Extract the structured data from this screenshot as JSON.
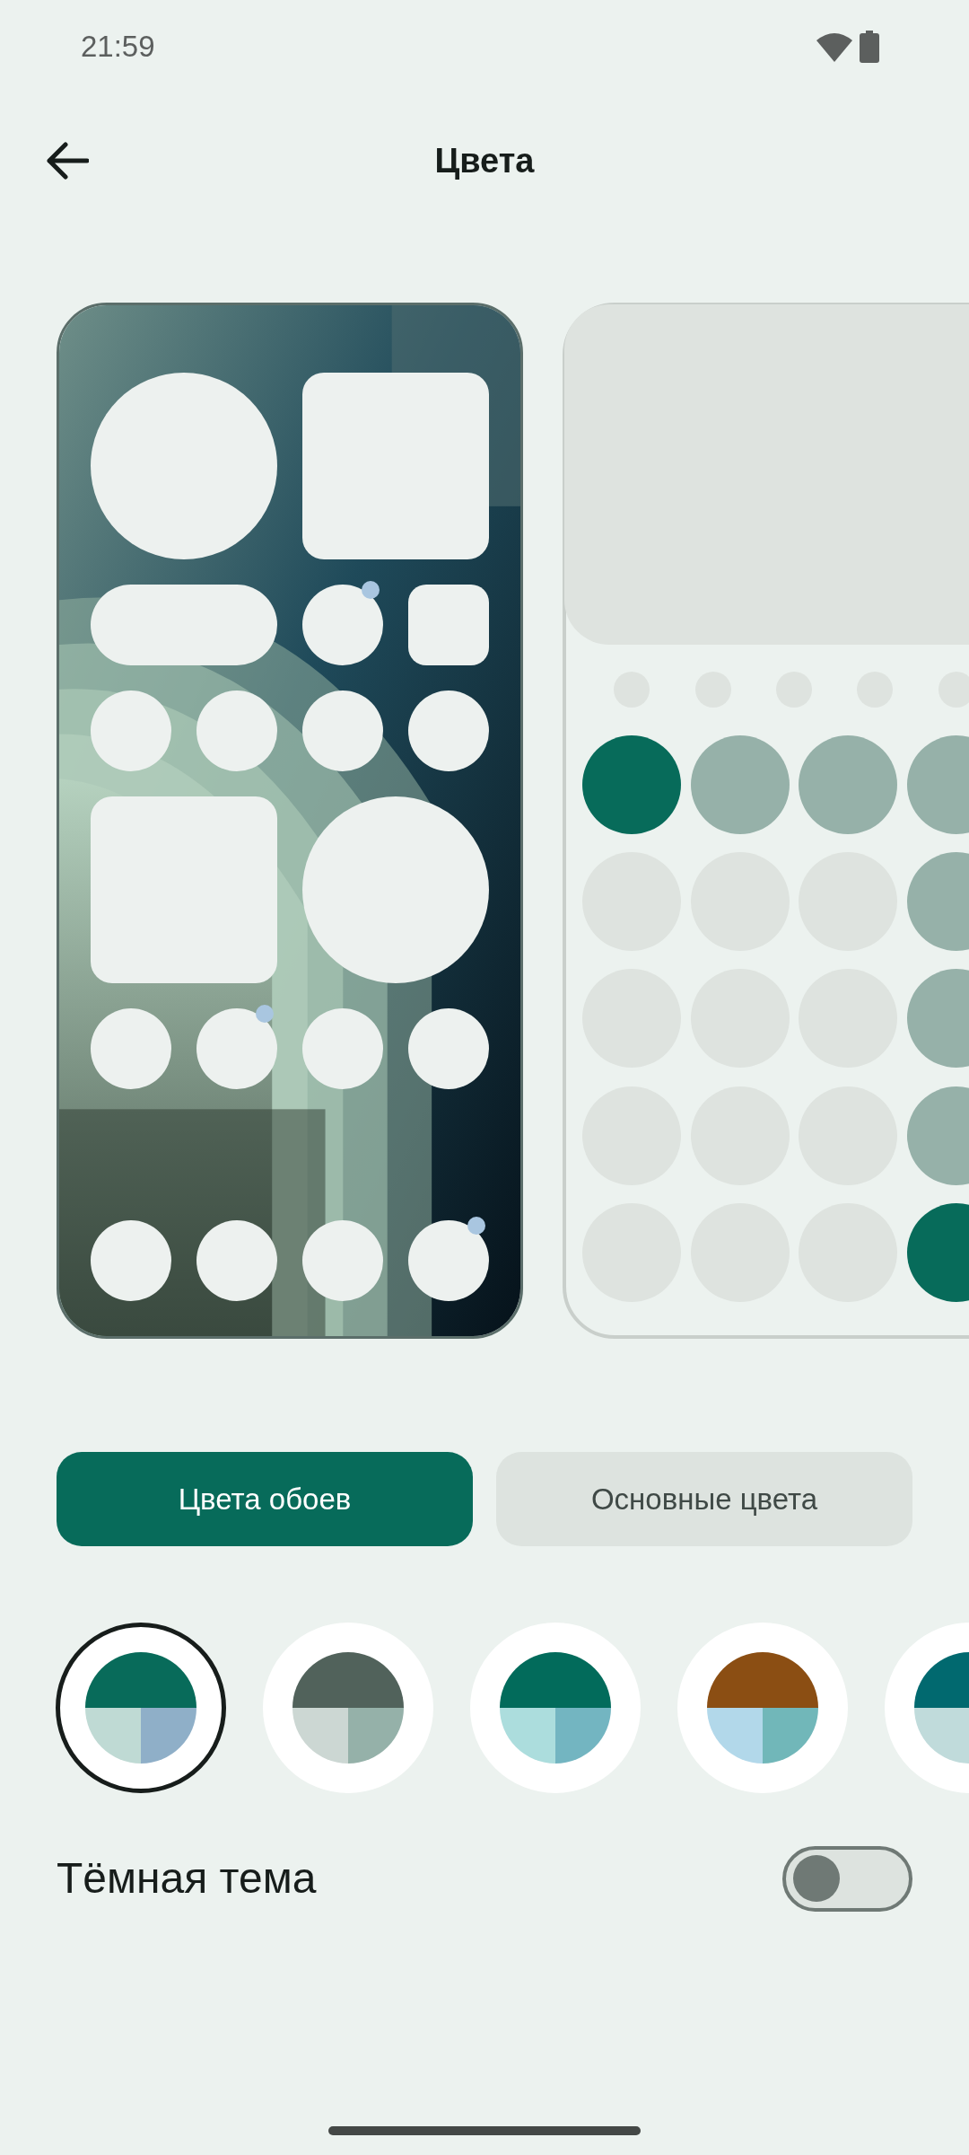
{
  "status_bar": {
    "time": "21:59"
  },
  "app_bar": {
    "title": "Цвета"
  },
  "tabs": [
    {
      "label": "Цвета обоев",
      "selected": true
    },
    {
      "label": "Основные цвета",
      "selected": false
    }
  ],
  "swatches": [
    {
      "selected": true,
      "segments": [
        {
          "color": "#086b5a"
        },
        {
          "color": "#bfdad4"
        },
        {
          "color": "#8fafc8"
        }
      ]
    },
    {
      "selected": false,
      "segments": [
        {
          "color": "#51625b"
        },
        {
          "color": "#ccd7d3"
        },
        {
          "color": "#95b1a9"
        }
      ]
    },
    {
      "selected": false,
      "segments": [
        {
          "color": "#026b5b"
        },
        {
          "color": "#acdddd"
        },
        {
          "color": "#73b5c1"
        }
      ]
    },
    {
      "selected": false,
      "segments": [
        {
          "color": "#8b4e13"
        },
        {
          "color": "#b2d8ea"
        },
        {
          "color": "#71b7b9"
        }
      ]
    },
    {
      "selected": false,
      "segments": [
        {
          "color": "#01696f"
        },
        {
          "color": "#c0dbdb"
        }
      ]
    }
  ],
  "dark_theme": {
    "label": "Тёмная тема",
    "on": false
  }
}
